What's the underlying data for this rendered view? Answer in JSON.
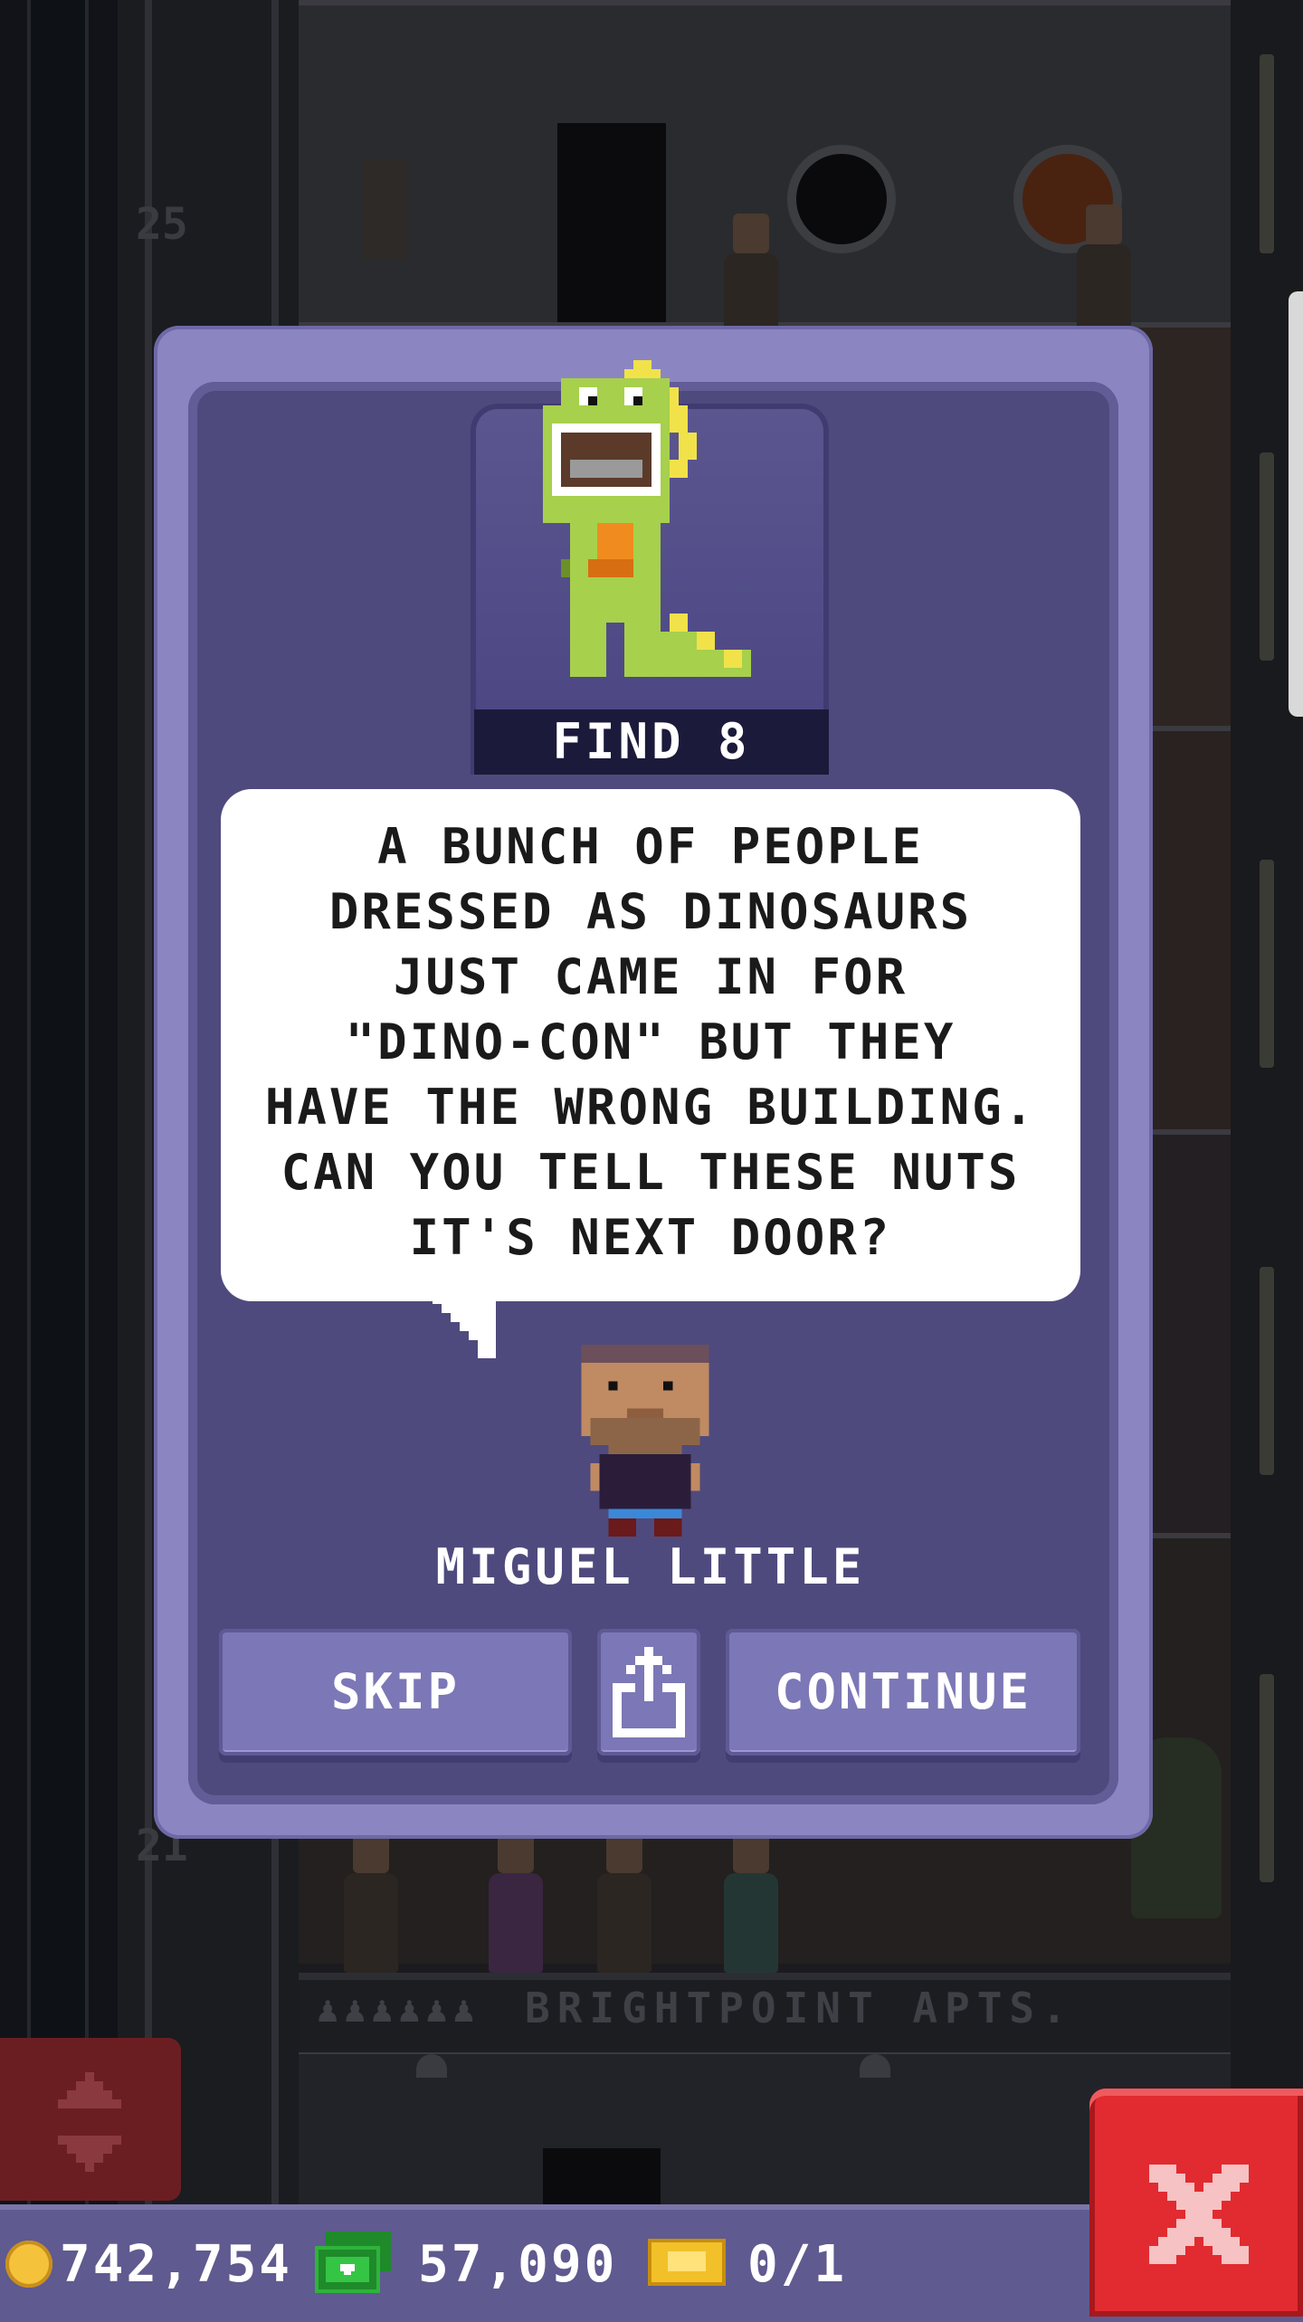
{
  "background": {
    "floor_numbers": [
      "25",
      "21"
    ],
    "lobby_sign": "BRIGHTPOINT APTS.",
    "lobby_sign_icons": "♟♟♟♟♟♟"
  },
  "dialog": {
    "mission_label": "FIND 8",
    "message": "A BUNCH OF PEOPLE\nDRESSED AS DINOSAURS\nJUST CAME IN FOR\n\"DINO-CON\" BUT THEY\nHAVE THE WRONG BUILDING.\nCAN YOU TELL THESE NUTS\nIT'S NEXT DOOR?",
    "speaker_name": "MIGUEL LITTLE",
    "skip_label": "SKIP",
    "share_icon": "share-icon",
    "continue_label": "CONTINUE",
    "portrait_icon": "dinosaur-costume-icon"
  },
  "hud": {
    "coins": "742,754",
    "bux": "57,090",
    "tickets": "0/1"
  },
  "colors": {
    "dialog_frame": "#8b86c2",
    "dialog_body": "#4f4a7d",
    "button": "#7c77b6",
    "close_button": "#e12b30",
    "hud": "#5f5a8f"
  }
}
